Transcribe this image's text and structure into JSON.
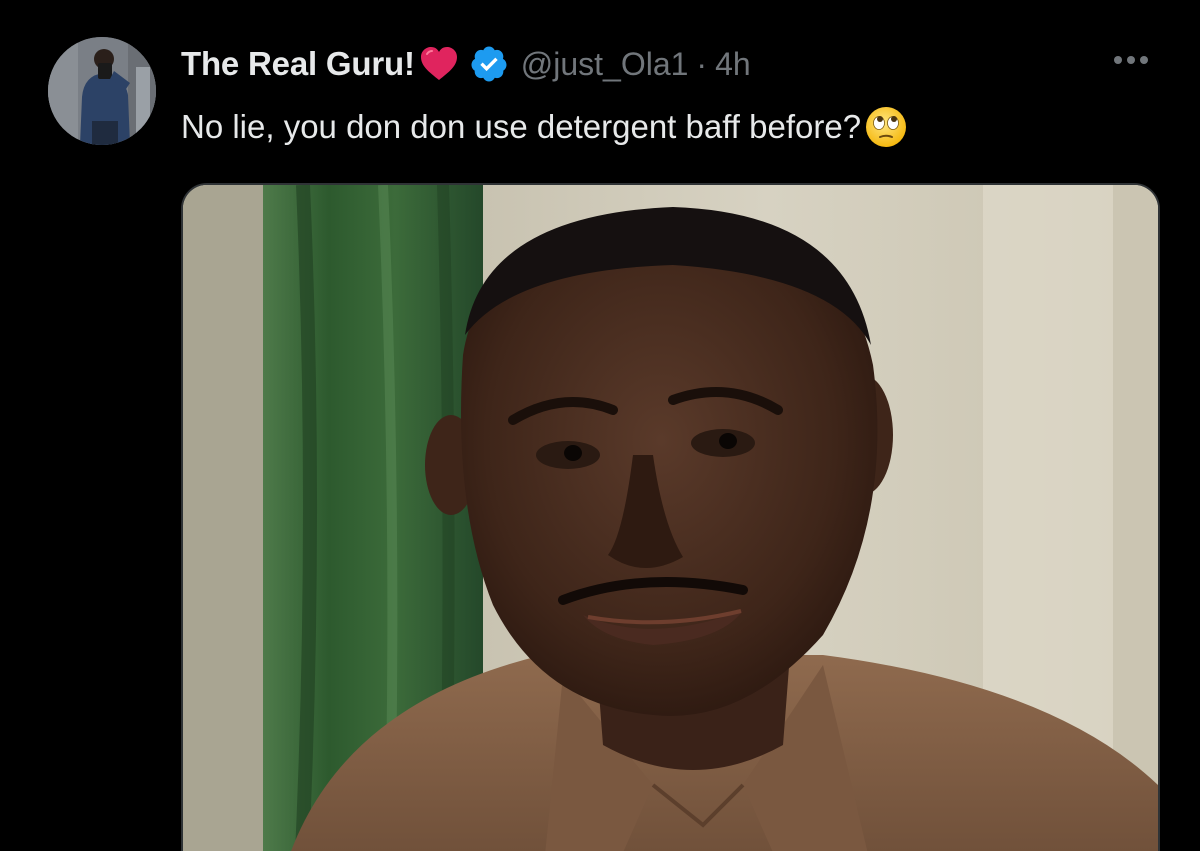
{
  "tweet": {
    "author": {
      "display_name": "The Real Guru!",
      "handle": "@just_Ola1",
      "separator": "·",
      "time": "4h",
      "name_emoji": "heart-icon",
      "badge": "verified-icon"
    },
    "text": "No lie, you don don use detergent baff before?",
    "text_emoji": "face-with-rolling-eyes-icon",
    "more_icon": "more-icon",
    "media": {
      "type": "image",
      "description_icon": "meme-photo"
    }
  },
  "colors": {
    "background": "#000000",
    "primary_text": "#e7e9ea",
    "secondary_text": "#71767b",
    "verified_blue": "#1d9bf0",
    "heart_red": "#e0245e",
    "border": "#2f3336"
  }
}
